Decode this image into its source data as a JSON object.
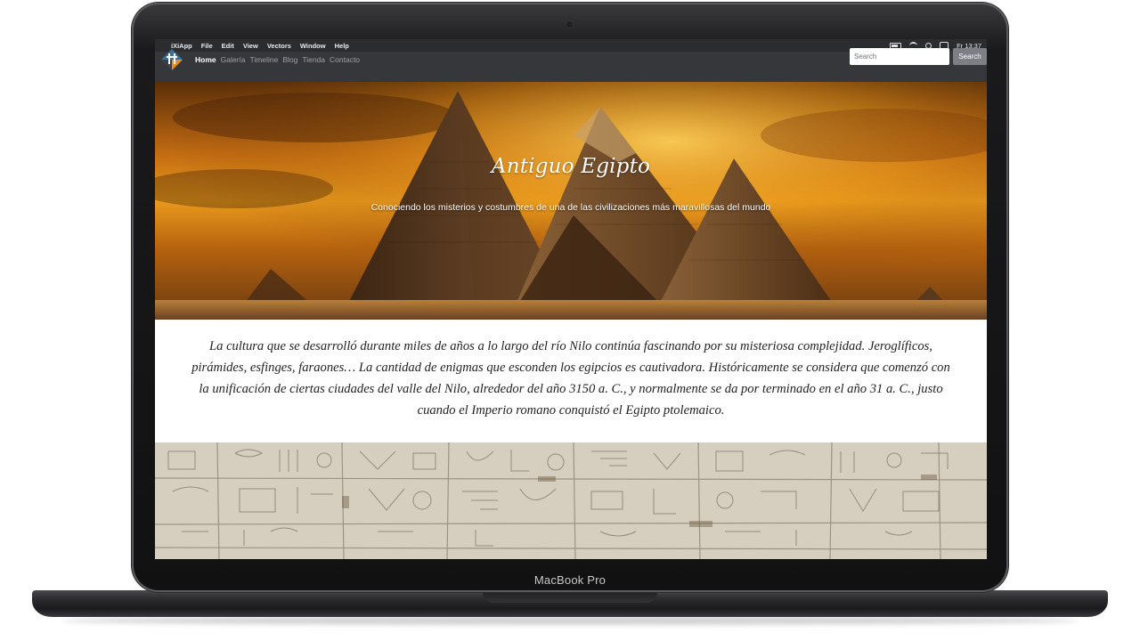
{
  "device": {
    "label": "MacBook Pro"
  },
  "menubar": {
    "app": "iXiApp",
    "items": [
      "File",
      "Edit",
      "View",
      "Vectors",
      "Window",
      "Help"
    ],
    "clock": "Fr 13:37"
  },
  "nav": {
    "links": [
      "Home",
      "Galería",
      "Timeline",
      "Blog",
      "Tienda",
      "Contacto"
    ],
    "active": "Home",
    "search_placeholder": "Search",
    "search_button": "Search"
  },
  "hero": {
    "title": "Antiguo Egipto",
    "subtitle": "Conociendo los misterios y costumbres de una de las civilizaciones más maravillosas del mundo"
  },
  "intro": {
    "text": "La cultura que se desarrolló durante miles de años a lo largo del río Nilo continúa fascinando por su misteriosa complejidad. Jeroglíficos, pirámides, esfinges, faraones… La cantidad de enigmas que esconden los egipcios es cautivadora. Históricamente se considera que comenzó con la unificación de ciertas ciudades del valle del Nilo, alrededor del año 3150 a. C., y normalmente se da por terminado en el año 31 a. C., justo cuando el Imperio romano conquistó el Egipto ptolemaico."
  },
  "icons": [
    "apple-icon",
    "battery-icon",
    "wifi-icon",
    "search-icon",
    "control-center-icon",
    "site-logo-icon"
  ],
  "colors": {
    "navbar": "#35373b",
    "menubar": "#2b2c30",
    "hero_gold": "#e99a1c",
    "search_button": "#7c7f84"
  }
}
